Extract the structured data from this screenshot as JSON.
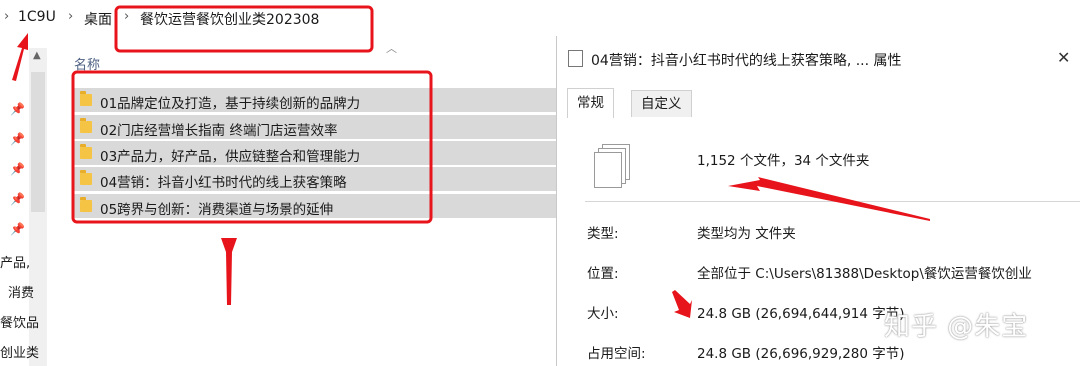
{
  "breadcrumb": {
    "root": "1C9U",
    "desktop": "桌面",
    "folder": "餐饮运营餐饮创业类202308"
  },
  "nav": {
    "fragments": [
      "产品,",
      "消费",
      "餐饮品",
      "创业类"
    ]
  },
  "file_list": {
    "column_name": "名称",
    "folders": [
      "01品牌定位及打造，基于持续创新的品牌力",
      "02门店经营增长指南 终端门店运营效率",
      "03产品力，好产品，供应链整合和管理能力",
      "04营销：抖音小红书时代的线上获客策略",
      "05跨界与创新：消费渠道与场景的延伸"
    ]
  },
  "properties": {
    "title": "04营销：抖音小红书时代的线上获客策略, ... 属性",
    "tabs": [
      "常规",
      "自定义"
    ],
    "summary": "1,152 个文件，34 个文件夹",
    "type_label": "类型:",
    "type_value": "类型均为 文件夹",
    "location_label": "位置:",
    "location_value": "全部位于 C:\\Users\\81388\\Desktop\\餐饮运营餐饮创业",
    "size_label": "大小:",
    "size_value": "24.8 GB (26,694,644,914 字节)",
    "disk_label": "占用空间:",
    "disk_value": "24.8 GB (26,696,929,280 字节)"
  },
  "watermark": "知乎 @朱宝",
  "colors": {
    "annotation_red": "#e8141b",
    "selection_gray": "#d9d9d9",
    "folder_yellow": "#f6c444"
  }
}
